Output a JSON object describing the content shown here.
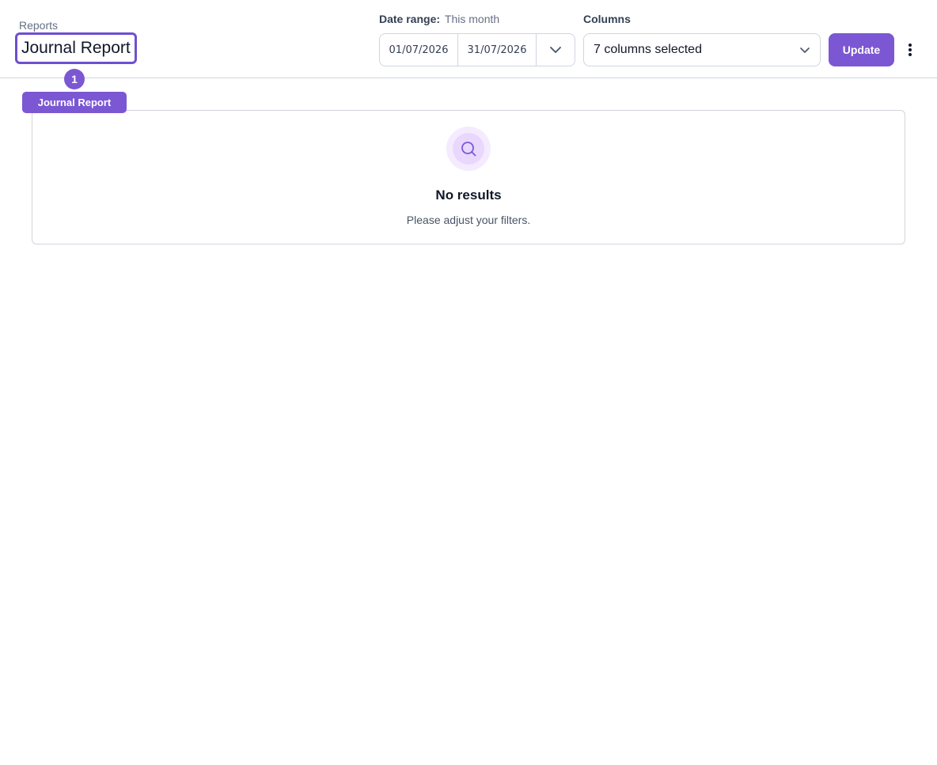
{
  "header": {
    "breadcrumb": "Reports",
    "title": "Journal Report"
  },
  "annotation": {
    "marker_number": "1",
    "marker_label": "Journal Report",
    "color": "#7c57d4"
  },
  "date_range": {
    "label": "Date range:",
    "preset": "This month",
    "start": "01/07/2026",
    "end": "31/07/2026",
    "toggle_icon": "chevron-down-icon"
  },
  "columns": {
    "label": "Columns",
    "value": "7 columns selected",
    "icon": "chevron-down-icon"
  },
  "actions": {
    "update_label": "Update",
    "more_icon": "vertical-dots-icon"
  },
  "empty_state": {
    "icon": "search-icon",
    "title": "No results",
    "message": "Please adjust your filters."
  },
  "colors": {
    "accent": "#7c57d4",
    "border": "#d0d5dd",
    "icon_bg": "#f4ebff"
  }
}
